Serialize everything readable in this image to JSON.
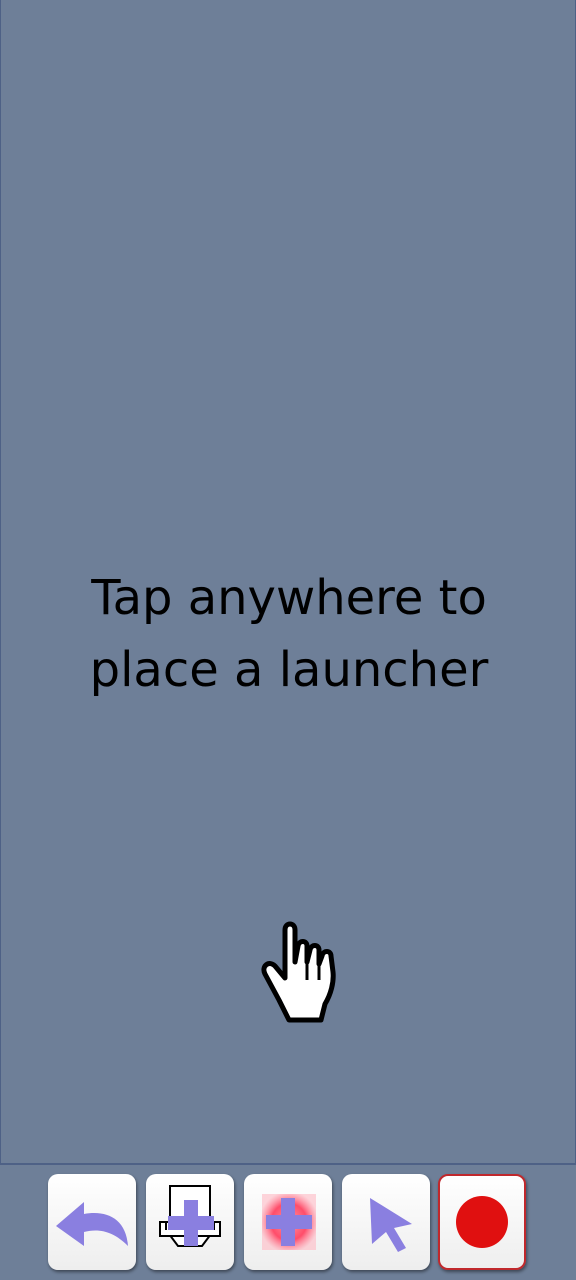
{
  "canvas": {
    "hint_line1": "Tap anywhere to",
    "hint_line2": "place a launcher"
  },
  "toolbar": {
    "buttons": [
      {
        "name": "undo",
        "icon": "undo-arrow-icon"
      },
      {
        "name": "add-keyboard-launcher",
        "icon": "keyboard-plus-icon"
      },
      {
        "name": "add-launcher",
        "icon": "plus-icon"
      },
      {
        "name": "select",
        "icon": "pointer-arrow-icon"
      },
      {
        "name": "record",
        "icon": "record-dot-icon"
      }
    ]
  },
  "colors": {
    "background": "#6e7f98",
    "accent": "#8a7fe0",
    "record": "#e01010"
  }
}
